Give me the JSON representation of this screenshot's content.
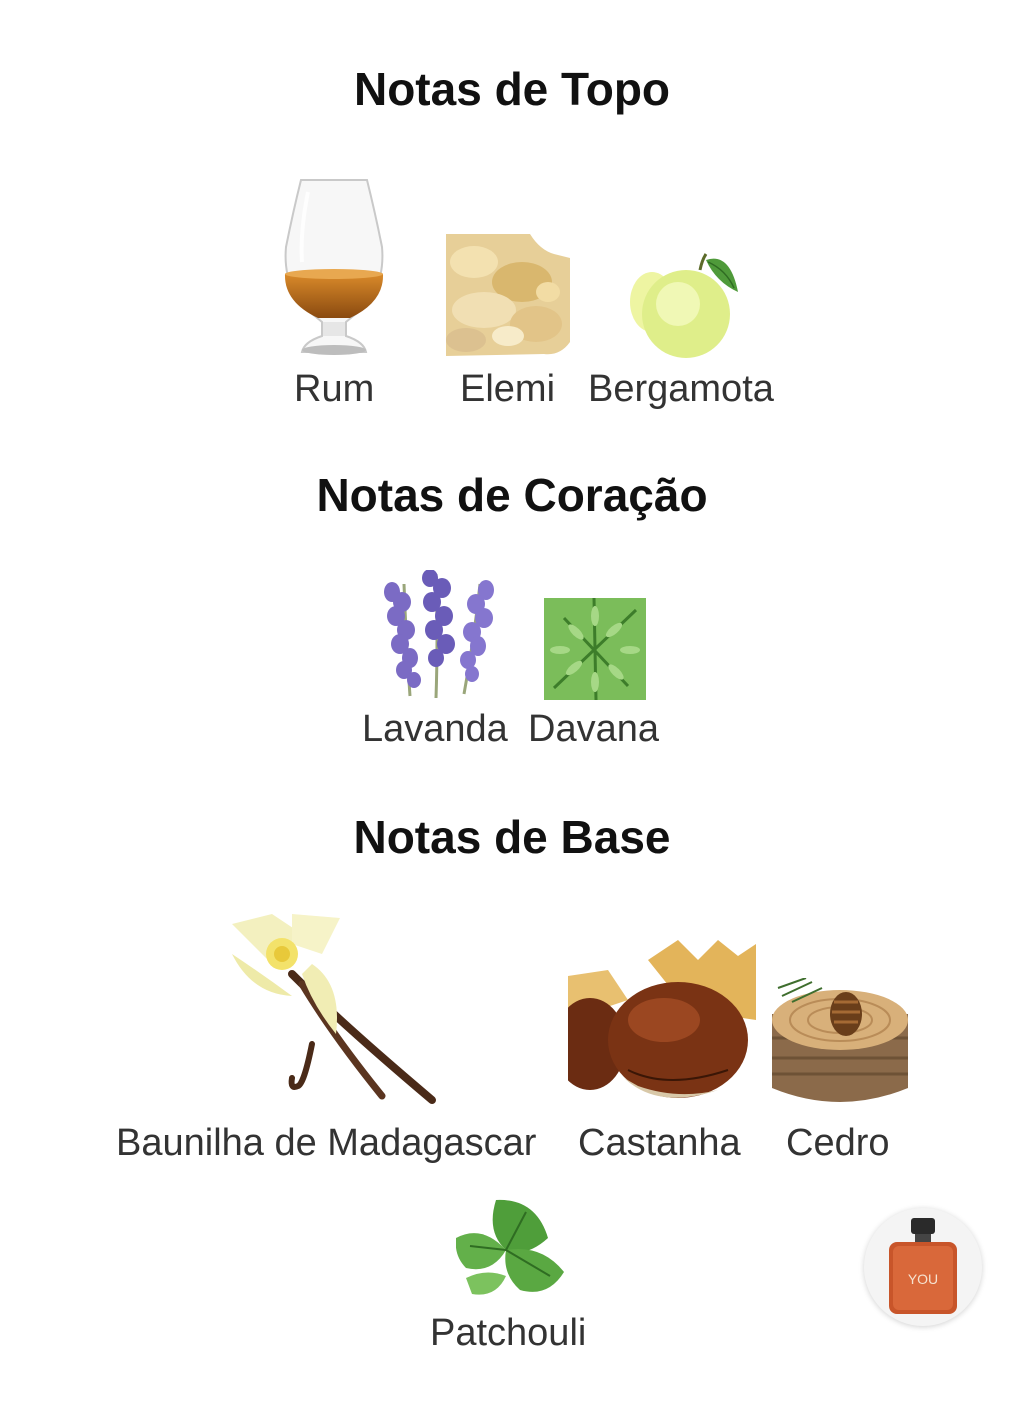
{
  "sections": {
    "top": {
      "title": "Notas de Topo",
      "notes": [
        {
          "label": "Rum",
          "icon": "rum-glass-icon"
        },
        {
          "label": "Elemi",
          "icon": "elemi-resin-icon"
        },
        {
          "label": "Bergamota",
          "icon": "bergamot-icon"
        }
      ]
    },
    "heart": {
      "title": "Notas de Coração",
      "notes": [
        {
          "label": "Lavanda",
          "icon": "lavender-icon"
        },
        {
          "label": "Davana",
          "icon": "davana-herb-icon"
        }
      ]
    },
    "base": {
      "title": "Notas de Base",
      "notes": [
        {
          "label": "Baunilha de Madagascar",
          "icon": "vanilla-icon"
        },
        {
          "label": "Castanha",
          "icon": "chestnut-icon"
        },
        {
          "label": "Cedro",
          "icon": "cedar-stump-icon"
        },
        {
          "label": "Patchouli",
          "icon": "patchouli-leaf-icon"
        }
      ]
    }
  },
  "floating_button": {
    "icon": "perfume-bottle-icon",
    "bottle_text": "YOU"
  },
  "colors": {
    "heading": "#111111",
    "label": "#333333",
    "background": "#ffffff"
  }
}
